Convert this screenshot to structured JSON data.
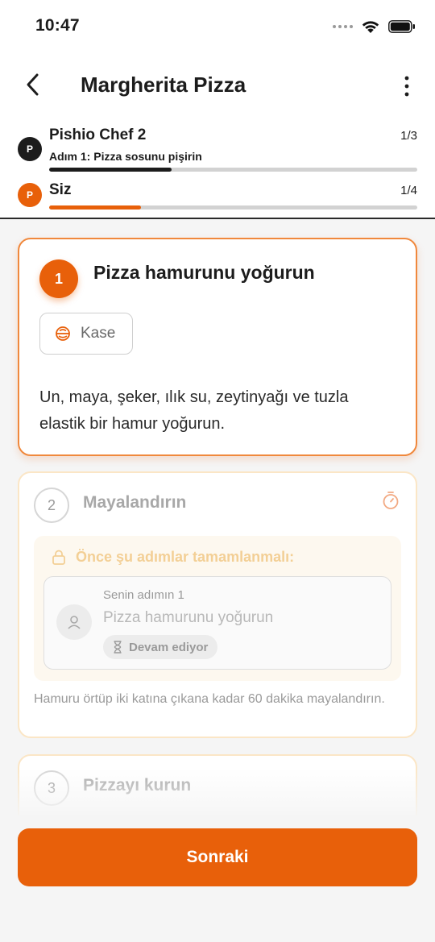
{
  "status_bar": {
    "time": "10:47"
  },
  "nav": {
    "title": "Margherita Pizza"
  },
  "progress": {
    "chef": {
      "avatar": "P",
      "name": "Pishio Chef 2",
      "count": "1/3",
      "current_step": "Adım 1: Pizza sosunu pişirin",
      "fraction": 0.333,
      "avatar_color": "#1c1c1c",
      "bar_color": "#1c1c1c"
    },
    "self": {
      "avatar": "P",
      "name": "Siz",
      "count": "1/4",
      "fraction": 0.25,
      "avatar_color": "#e8600a",
      "bar_color": "#e8600a"
    }
  },
  "steps": [
    {
      "number": "1",
      "title": "Pizza hamurunu yoğurun",
      "tool": {
        "icon": "bowl-icon",
        "label": "Kase"
      },
      "description": "Un, maya, şeker, ılık su, zeytinyağı ve tuzla elastik bir hamur yoğurun."
    },
    {
      "number": "2",
      "title": "Mayalandırın",
      "icon": "timer-icon",
      "prerequisite": {
        "heading": "Önce şu adımlar tamamlanmalı:",
        "item": {
          "subtitle": "Senin adımın 1",
          "name": "Pizza hamurunu yoğurun",
          "status": "Devam ediyor"
        }
      },
      "description": "Hamuru örtüp iki katına çıkana kadar 60 dakika mayalandırın."
    },
    {
      "number": "3",
      "title": "Pizzayı kurun"
    }
  ],
  "footer": {
    "next_label": "Sonraki"
  },
  "colors": {
    "accent": "#e8600a",
    "locked_border": "#fbe6c6"
  }
}
